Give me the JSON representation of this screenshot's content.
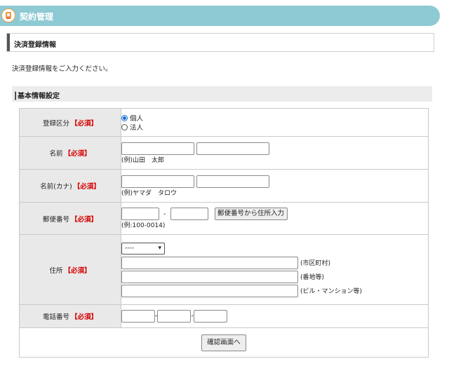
{
  "header": {
    "title": "契約管理",
    "icon": "contract-icon",
    "accent": "#8ecad3"
  },
  "section": {
    "title": "決済登録情報"
  },
  "intro": "決済登録情報をご入力ください。",
  "subhead": "┃基本情報設定",
  "required_mark": "【必須】",
  "form": {
    "category": {
      "label": "登録区分",
      "options": [
        "個人",
        "法人"
      ],
      "selected": "個人"
    },
    "name": {
      "label": "名前",
      "hint": "(例)山田　太郎"
    },
    "kana": {
      "label": "名前(カナ)",
      "hint": "(例)ヤマダ　タロウ"
    },
    "postal": {
      "label": "郵便番号",
      "separator": "-",
      "button": "郵便番号から住所入力",
      "hint": "(例:100-0014)"
    },
    "address": {
      "label": "住所",
      "prefecture_value": "----",
      "line1_label": "(市区町村)",
      "line2_label": "(番地等)",
      "line3_label": "(ビル・マンション等)"
    },
    "phone": {
      "label": "電話番号",
      "separator": "-"
    },
    "confirm_button": "確認画面へ"
  }
}
